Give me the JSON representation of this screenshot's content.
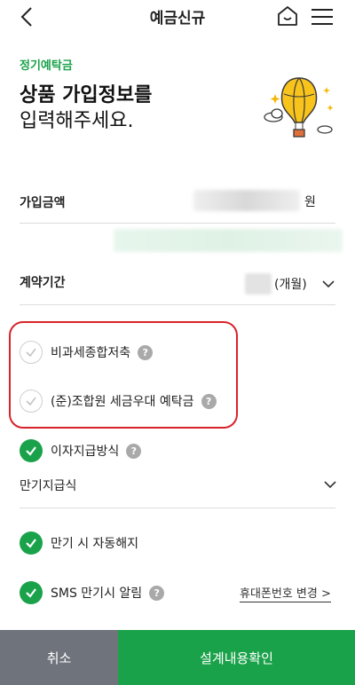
{
  "header": {
    "title": "예금신규"
  },
  "product": {
    "category": "정기예탁금",
    "heading_line1": "상품 가입정보를",
    "heading_line2": "입력해주세요."
  },
  "amount": {
    "label": "가입금액",
    "unit": "원"
  },
  "period": {
    "label": "계약기간",
    "unit": "(개월)"
  },
  "tax_options": [
    {
      "label": "비과세종합저축",
      "checked": false
    },
    {
      "label": "(준)조합원 세금우대 예탁금",
      "checked": false
    }
  ],
  "interest": {
    "label": "이자지급방식",
    "checked": true,
    "selected": "만기지급식"
  },
  "auto_close": {
    "label": "만기 시 자동해지",
    "checked": true
  },
  "sms_alert": {
    "label": "SMS 만기시 알림",
    "checked": true,
    "link": "휴대폰번호 변경 >"
  },
  "footer": {
    "cancel": "취소",
    "confirm": "설계내용확인"
  },
  "colors": {
    "accent": "#1aa24a",
    "highlight_box": "#d8232a",
    "cancel_bg": "#6e737c"
  }
}
